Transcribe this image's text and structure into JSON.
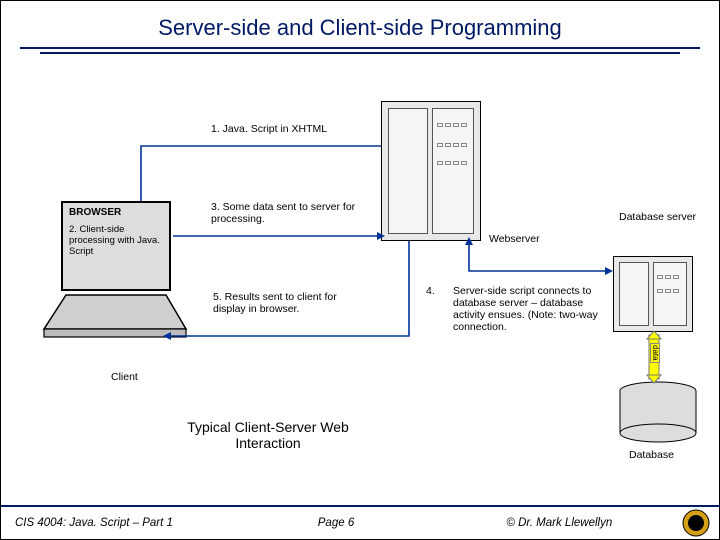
{
  "title": "Server-side and Client-side Programming",
  "steps": {
    "s1": "1.  Java. Script in XHTML",
    "s2": "2. Client-side processing with Java. Script",
    "s3": "3.  Some data sent to server for processing.",
    "s4num": "4.",
    "s4": "Server-side script connects to database server – database activity ensues. (Note: two-way connection.",
    "s5": "5.  Results sent to client for display in browser."
  },
  "labels": {
    "browser": "BROWSER",
    "webserver": "Webserver",
    "dbserver": "Database server",
    "client": "Client",
    "database": "Database",
    "data": "data"
  },
  "caption": "Typical Client-Server Web Interaction",
  "footer": {
    "left": "CIS 4004: Java. Script – Part 1",
    "mid": "Page 6",
    "right": "© Dr. Mark Llewellyn"
  }
}
